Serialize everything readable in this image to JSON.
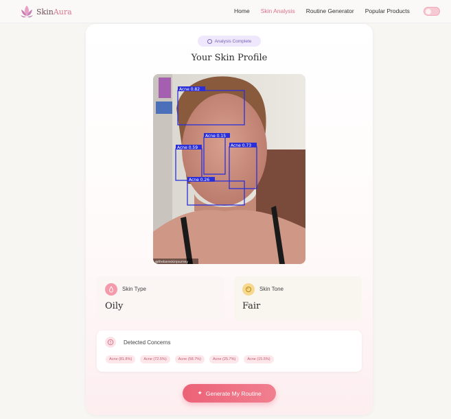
{
  "brand": {
    "name_part1": "Skin",
    "name_part2": "Aura"
  },
  "nav": {
    "items": [
      {
        "label": "Home",
        "active": false
      },
      {
        "label": "Skin Analysis",
        "active": true
      },
      {
        "label": "Routine Generator",
        "active": false
      },
      {
        "label": "Popular Products",
        "active": false
      }
    ],
    "theme_toggle_icon": "sun-icon"
  },
  "analysis": {
    "status_badge": "Analysis Complete",
    "title": "Your Skin Profile",
    "photo": {
      "detections": [
        {
          "label": "Acne 0.82"
        },
        {
          "label": "Acne 0.15"
        },
        {
          "label": "Acne 0.59"
        },
        {
          "label": "Acne 0.73"
        },
        {
          "label": "Acne 0.26"
        }
      ],
      "watermark": "@thebareskinjourney"
    },
    "skin_type": {
      "label": "Skin Type",
      "value": "Oily",
      "icon": "droplet-icon"
    },
    "skin_tone": {
      "label": "Skin Tone",
      "value": "Fair",
      "icon": "palette-icon"
    },
    "concerns": {
      "label": "Detected Concerns",
      "icon": "alert-circle-icon",
      "tags": [
        "Acne (81.8%)",
        "Acne (72.5%)",
        "Acne (58.7%)",
        "Acne (25.7%)",
        "Acne (15.5%)"
      ]
    },
    "generate_button": "Generate My Routine"
  },
  "colors": {
    "accent": "#e0708a",
    "button": "#ec6277",
    "badge_bg": "#efe7fb",
    "detection_box": "#2b2fd9"
  }
}
